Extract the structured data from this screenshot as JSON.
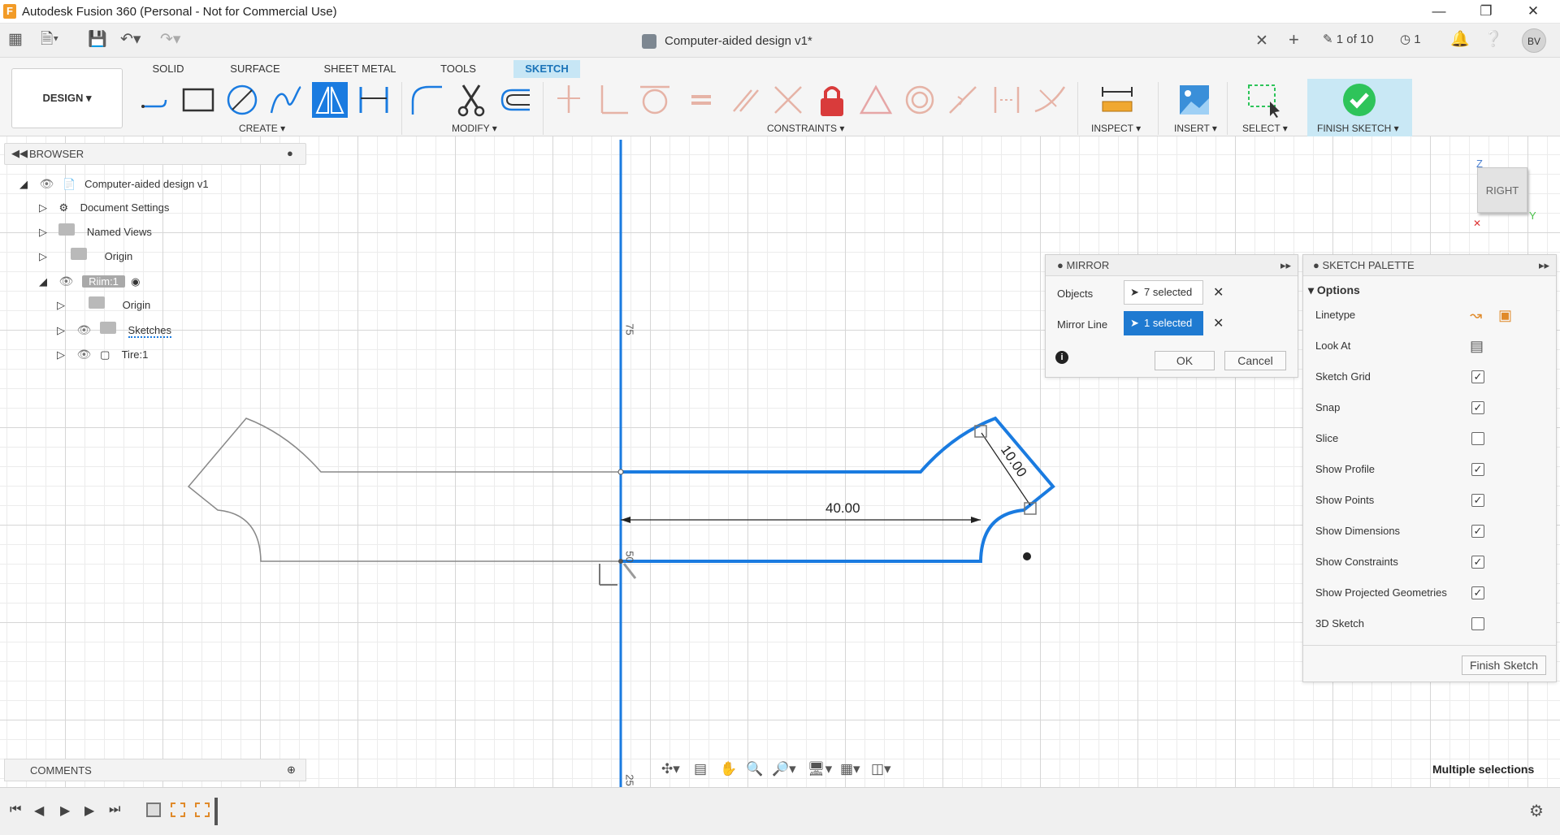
{
  "titlebar": {
    "title": "Autodesk Fusion 360 (Personal - Not for Commercial Use)",
    "app_letter": "F"
  },
  "appbar": {
    "document_name": "Computer-aided design v1*",
    "version_count": "1 of 10",
    "jobs_count": "1",
    "user_initials": "BV"
  },
  "ribbon": {
    "workspace": "DESIGN",
    "tabs": [
      "SOLID",
      "SURFACE",
      "SHEET METAL",
      "TOOLS",
      "SKETCH"
    ],
    "active_tab": "SKETCH",
    "groups": {
      "create": "CREATE",
      "modify": "MODIFY",
      "constraints": "CONSTRAINTS",
      "inspect": "INSPECT",
      "insert": "INSERT",
      "select": "SELECT",
      "finish": "FINISH SKETCH"
    }
  },
  "browser": {
    "title": "BROWSER",
    "items": [
      {
        "label": "Computer-aided design v1"
      },
      {
        "label": "Document Settings"
      },
      {
        "label": "Named Views"
      },
      {
        "label": "Origin"
      },
      {
        "label": "Riim:1"
      },
      {
        "label": "Origin"
      },
      {
        "label": "Sketches"
      },
      {
        "label": "Tire:1"
      }
    ]
  },
  "mirror": {
    "title": "MIRROR",
    "objects_label": "Objects",
    "objects_value": "7 selected",
    "mirror_line_label": "Mirror Line",
    "mirror_line_value": "1 selected",
    "ok": "OK",
    "cancel": "Cancel"
  },
  "palette": {
    "title": "SKETCH PALETTE",
    "section": "Options",
    "options": [
      {
        "label": "Linetype",
        "kind": "icons"
      },
      {
        "label": "Look At",
        "kind": "icon"
      },
      {
        "label": "Sketch Grid",
        "checked": true
      },
      {
        "label": "Snap",
        "checked": true
      },
      {
        "label": "Slice",
        "checked": false
      },
      {
        "label": "Show Profile",
        "checked": true
      },
      {
        "label": "Show Points",
        "checked": true
      },
      {
        "label": "Show Dimensions",
        "checked": true
      },
      {
        "label": "Show Constraints",
        "checked": true
      },
      {
        "label": "Show Projected Geometries",
        "checked": true
      },
      {
        "label": "3D Sketch",
        "checked": false
      }
    ],
    "finish_button": "Finish Sketch"
  },
  "canvas": {
    "dimension_width": "40.00",
    "dimension_angled": "10.00",
    "axis_label_upper": "75",
    "axis_label_lower": "50",
    "axis_label_bottom": "25",
    "viewcube_face": "RIGHT",
    "axis_z": "Z",
    "axis_y": "Y",
    "status": "Multiple selections"
  },
  "comments": {
    "title": "COMMENTS"
  },
  "colors": {
    "accent": "#1f7ad1",
    "sketch_line": "#1a7be0",
    "ribbon_active": "#c7e6f5",
    "finish_green": "#2ec45a"
  }
}
